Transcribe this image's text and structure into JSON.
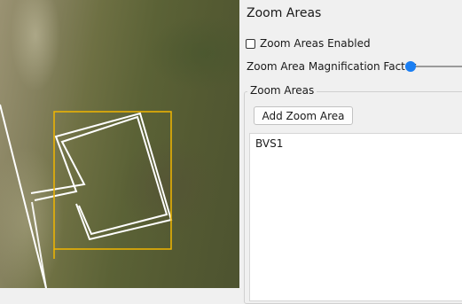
{
  "map": {
    "zoom_area_color": "#f2b600",
    "polygon_color": "#ffffff"
  },
  "panel": {
    "title": "Zoom Areas",
    "enabled_checkbox": {
      "label": "Zoom Areas Enabled",
      "checked": false
    },
    "magnification": {
      "label": "Zoom Area Magnification Factor",
      "accent": "#1a7ef2"
    },
    "group": {
      "title": "Zoom Areas",
      "add_button_label": "Add Zoom Area",
      "items": [
        "BVS1"
      ]
    }
  }
}
